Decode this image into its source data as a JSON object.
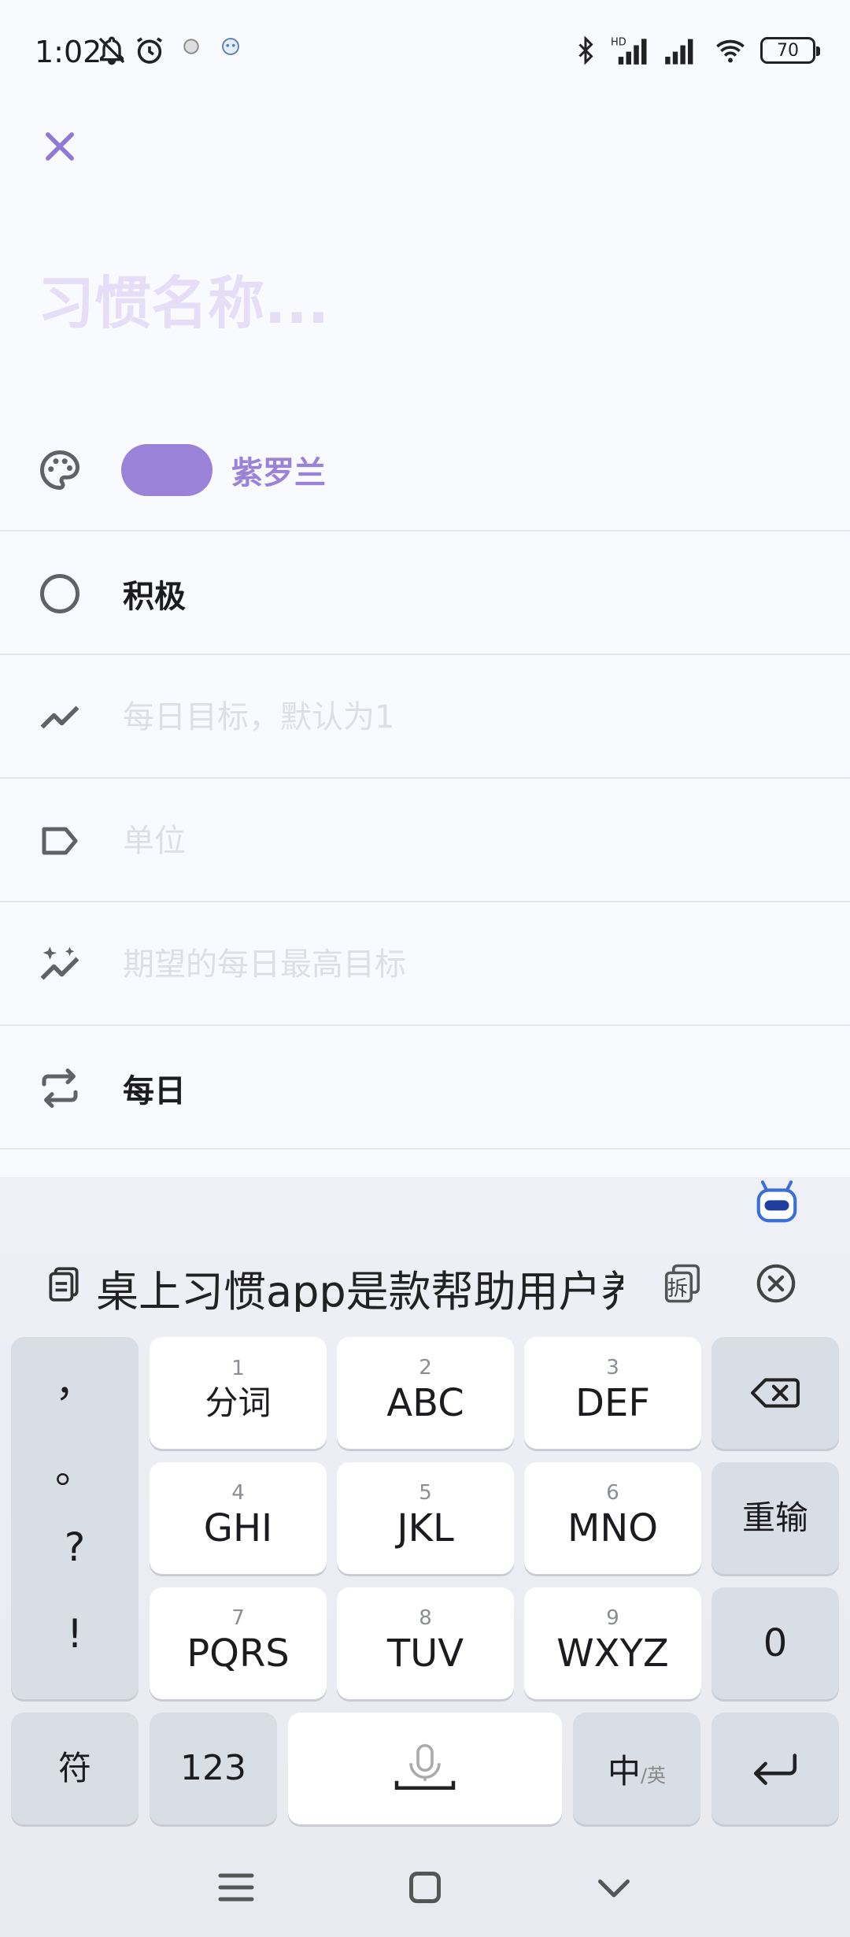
{
  "status_bar": {
    "time": "1:02",
    "battery": "70",
    "left_icons": [
      "bell-off-icon",
      "alarm-icon",
      "app-icon-a",
      "app-icon-b"
    ],
    "right_icons": [
      "bluetooth-icon",
      "signal-hd-icon",
      "signal-icon",
      "wifi-icon",
      "battery-icon"
    ]
  },
  "header": {
    "close_icon": "close-icon"
  },
  "habit": {
    "name_placeholder": "习惯名称..."
  },
  "colors": {
    "accent": "#9a82d9",
    "accent_text": "#9a82d9",
    "icon_gray": "#5f6368"
  },
  "rows": {
    "color": {
      "icon": "palette-icon",
      "label": "紫罗兰",
      "swatch": "#9a82d9"
    },
    "polarity": {
      "icon": "radio-icon",
      "label": "积极"
    },
    "daily_goal": {
      "icon": "trend-icon",
      "placeholder": "每日目标，默认为1"
    },
    "unit": {
      "icon": "label-icon",
      "placeholder": "单位"
    },
    "max_goal": {
      "icon": "sparkle-trend-icon",
      "placeholder": "期望的每日最高目标"
    },
    "repeat": {
      "icon": "repeat-icon",
      "label": "每日"
    }
  },
  "keyboard": {
    "clipboard_text": "桌上习惯app是款帮助用户养",
    "split_label": "拆",
    "punctuation": [
      "，",
      "。",
      "?",
      "!"
    ],
    "keys": [
      {
        "num": "1",
        "label": "分词"
      },
      {
        "num": "2",
        "label": "ABC"
      },
      {
        "num": "3",
        "label": "DEF"
      },
      {
        "num": "4",
        "label": "GHI"
      },
      {
        "num": "5",
        "label": "JKL"
      },
      {
        "num": "6",
        "label": "MNO"
      },
      {
        "num": "7",
        "label": "PQRS"
      },
      {
        "num": "8",
        "label": "TUV"
      },
      {
        "num": "9",
        "label": "WXYZ"
      }
    ],
    "reinput": "重输",
    "zero": "0",
    "symbols": "符",
    "numbers": "123",
    "lang_main": "中",
    "lang_sub": "/英"
  },
  "nav": {
    "icons": [
      "menu-icon",
      "home-icon",
      "back-icon"
    ]
  }
}
